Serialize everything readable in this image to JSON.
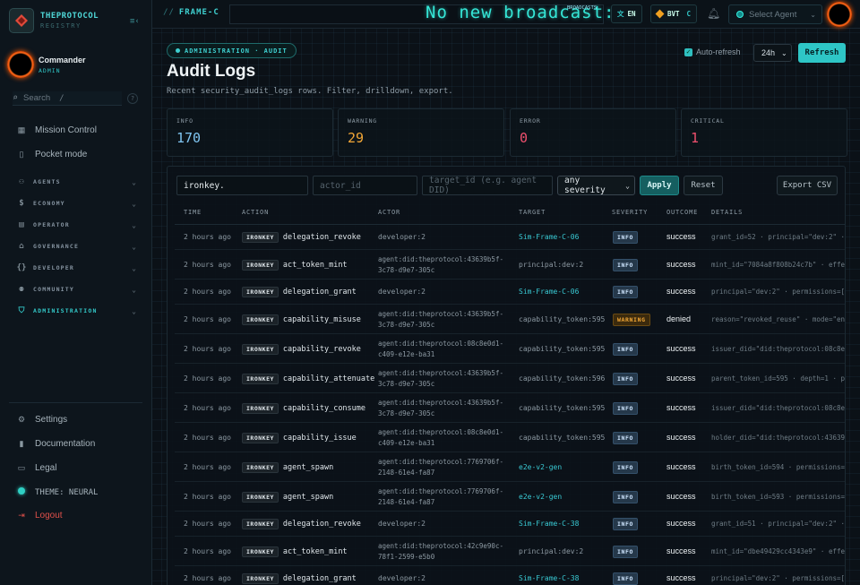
{
  "brand": {
    "name": "THEPROTOCOL",
    "sub": "REGISTRY"
  },
  "user": {
    "name": "Commander",
    "role": "ADMIN"
  },
  "search": {
    "placeholder": "Search",
    "kbd": "/",
    "help": "?"
  },
  "nav": {
    "mission_control": "Mission Control",
    "pocket_mode": "Pocket mode",
    "sections": [
      "AGENTS",
      "ECONOMY",
      "OPERATOR",
      "GOVERNANCE",
      "DEVELOPER",
      "COMMUNITY",
      "ADMINISTRATION"
    ],
    "settings": "Settings",
    "documentation": "Documentation",
    "legal": "Legal",
    "theme": "THEME: NEURAL",
    "logout": "Logout"
  },
  "topbar": {
    "crumb_sep": "//",
    "crumb": "FRAME-C",
    "broadcast": "No new broadcast:",
    "broadcast_tag": "BROADCASTS",
    "lang_icon": "文",
    "lang": "EN",
    "token": "BVT",
    "token_suffix": "C",
    "agent_select": "Select Agent"
  },
  "page": {
    "badge": "ADMINISTRATION · AUDIT",
    "title": "Audit Logs",
    "subtitle": "Recent security_audit_logs rows. Filter, drilldown, export.",
    "autorefresh": "Auto-refresh",
    "range": "24h",
    "refresh": "Refresh"
  },
  "stats": [
    {
      "label": "INFO",
      "value": "170",
      "color": "#7fc4f0"
    },
    {
      "label": "WARNING",
      "value": "29",
      "color": "#f3a736"
    },
    {
      "label": "ERROR",
      "value": "0",
      "color": "#f0506e"
    },
    {
      "label": "CRITICAL",
      "value": "1",
      "color": "#f0506e"
    }
  ],
  "filters": {
    "query": "ironkey.",
    "actor_placeholder": "actor_id",
    "target_placeholder": "target_id (e.g. agent DID)",
    "severity": "any severity",
    "apply": "Apply",
    "reset": "Reset",
    "export": "Export CSV"
  },
  "table": {
    "headers": [
      "TIME",
      "ACTION",
      "ACTOR",
      "TARGET",
      "SEVERITY",
      "OUTCOME",
      "DETAILS"
    ],
    "rows": [
      {
        "time": "2 hours ago",
        "tag": "IRONKEY",
        "action": "delegation_revoke",
        "actor": [
          "developer:2"
        ],
        "target": "Sim-Frame-C-06",
        "target_link": true,
        "severity": "INFO",
        "outcome": "success",
        "details": "grant_id=52 · principal=\"dev:2\" · r"
      },
      {
        "time": "2 hours ago",
        "tag": "IRONKEY",
        "action": "act_token_mint",
        "actor": [
          "agent:did:theprotocol:43639b5f-",
          "3c78-d9e7-305c"
        ],
        "target": "principal:dev:2",
        "target_link": false,
        "severity": "INFO",
        "outcome": "success",
        "details": "mint_id=\"7084a8f808b24c7b\" · effect"
      },
      {
        "time": "2 hours ago",
        "tag": "IRONKEY",
        "action": "delegation_grant",
        "actor": [
          "developer:2"
        ],
        "target": "Sim-Frame-C-06",
        "target_link": true,
        "severity": "INFO",
        "outcome": "success",
        "details": "principal=\"dev:2\" · permissions=[\"t"
      },
      {
        "time": "2 hours ago",
        "tag": "IRONKEY",
        "action": "capability_misuse",
        "actor": [
          "agent:did:theprotocol:43639b5f-",
          "3c78-d9e7-305c"
        ],
        "target": "capability_token:595",
        "target_link": false,
        "severity": "WARNING",
        "outcome": "denied",
        "details": "reason=\"revoked_reuse\" · mode=\"enfo"
      },
      {
        "time": "2 hours ago",
        "tag": "IRONKEY",
        "action": "capability_revoke",
        "actor": [
          "agent:did:theprotocol:08c8e0d1-",
          "c409-e12e-ba31"
        ],
        "target": "capability_token:595",
        "target_link": false,
        "severity": "INFO",
        "outcome": "success",
        "details": "issuer_did=\"did:theprotocol:08c8e0d"
      },
      {
        "time": "2 hours ago",
        "tag": "IRONKEY",
        "action": "capability_attenuate",
        "actor": [
          "agent:did:theprotocol:43639b5f-",
          "3c78-d9e7-305c"
        ],
        "target": "capability_token:596",
        "target_link": false,
        "severity": "INFO",
        "outcome": "success",
        "details": "parent_token_id=595 · depth=1 · perm"
      },
      {
        "time": "2 hours ago",
        "tag": "IRONKEY",
        "action": "capability_consume",
        "actor": [
          "agent:did:theprotocol:43639b5f-",
          "3c78-d9e7-305c"
        ],
        "target": "capability_token:595",
        "target_link": false,
        "severity": "INFO",
        "outcome": "success",
        "details": "issuer_did=\"did:theprotocol:08c8e0d"
      },
      {
        "time": "2 hours ago",
        "tag": "IRONKEY",
        "action": "capability_issue",
        "actor": [
          "agent:did:theprotocol:08c8e0d1-",
          "c409-e12e-ba31"
        ],
        "target": "capability_token:595",
        "target_link": false,
        "severity": "INFO",
        "outcome": "success",
        "details": "holder_did=\"did:theprotocol:43639b5"
      },
      {
        "time": "2 hours ago",
        "tag": "IRONKEY",
        "action": "agent_spawn",
        "actor": [
          "agent:did:theprotocol:7769706f-",
          "2148-61e4-fa87"
        ],
        "target": "e2e-v2-gen",
        "target_link": true,
        "severity": "INFO",
        "outcome": "success",
        "details": "birth_token_id=594 · permissions=[\""
      },
      {
        "time": "2 hours ago",
        "tag": "IRONKEY",
        "action": "agent_spawn",
        "actor": [
          "agent:did:theprotocol:7769706f-",
          "2148-61e4-fa87"
        ],
        "target": "e2e-v2-gen",
        "target_link": true,
        "severity": "INFO",
        "outcome": "success",
        "details": "birth_token_id=593 · permissions=[\""
      },
      {
        "time": "2 hours ago",
        "tag": "IRONKEY",
        "action": "delegation_revoke",
        "actor": [
          "developer:2"
        ],
        "target": "Sim-Frame-C-38",
        "target_link": true,
        "severity": "INFO",
        "outcome": "success",
        "details": "grant_id=51 · principal=\"dev:2\" · r"
      },
      {
        "time": "2 hours ago",
        "tag": "IRONKEY",
        "action": "act_token_mint",
        "actor": [
          "agent:did:theprotocol:42c9e90c-",
          "78f1-2599-e5b0"
        ],
        "target": "principal:dev:2",
        "target_link": false,
        "severity": "INFO",
        "outcome": "success",
        "details": "mint_id=\"dbe49429cc4343e9\" · effect"
      },
      {
        "time": "2 hours ago",
        "tag": "IRONKEY",
        "action": "delegation_grant",
        "actor": [
          "developer:2"
        ],
        "target": "Sim-Frame-C-38",
        "target_link": true,
        "severity": "INFO",
        "outcome": "success",
        "details": "principal=\"dev:2\" · permissions=[\"t"
      }
    ]
  }
}
